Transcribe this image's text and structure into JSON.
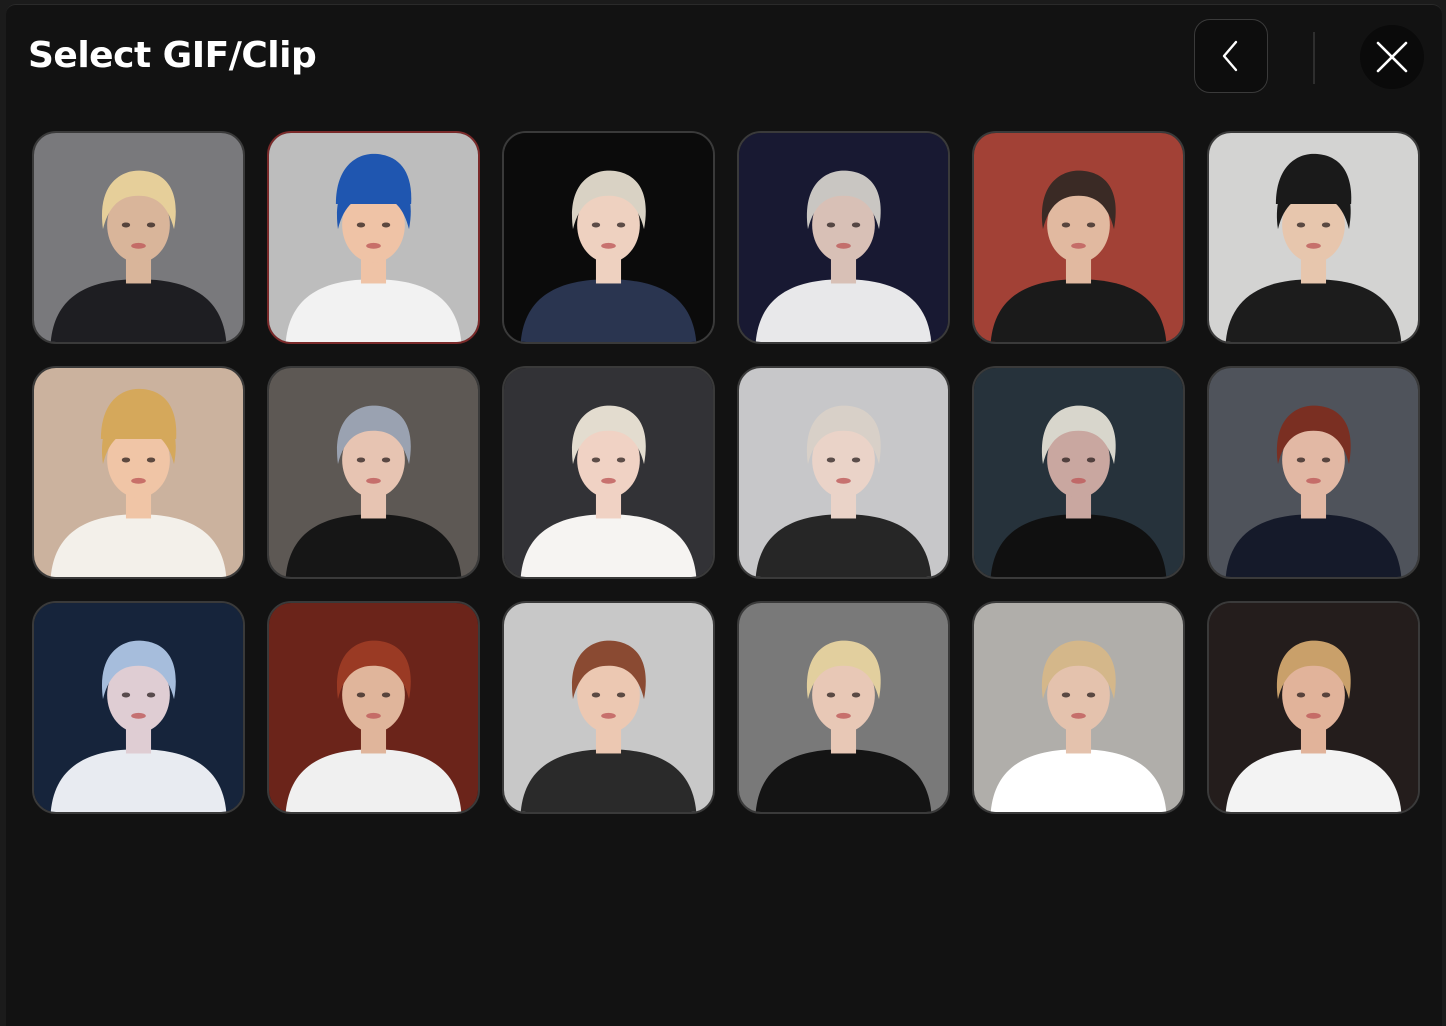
{
  "header": {
    "title": "Select GIF/Clip",
    "back_icon": "chevron-left-icon",
    "close_icon": "close-icon"
  },
  "selected_index": 1,
  "clips": [
    {
      "bg": "#8a8a8e",
      "hair": "#e6cf9a",
      "skin": "#d9b59a",
      "shirt": "#1e1e22"
    },
    {
      "bg": "#d8d8d8",
      "hair": "#1f56b0",
      "skin": "#efc3a6",
      "shirt": "#f2f2f2",
      "hat": true
    },
    {
      "bg": "#0d0d0d",
      "hair": "#d9d2c4",
      "skin": "#eed1c0",
      "shirt": "#2a3550"
    },
    {
      "bg": "#1c1d3a",
      "hair": "#c9c6c2",
      "skin": "#d8c0b6",
      "shirt": "#e8e8ea"
    },
    {
      "bg": "#b94a3e",
      "hair": "#3a2a25",
      "skin": "#e1b9a0",
      "shirt": "#1a1a1a"
    },
    {
      "bg": "#f1f1ef",
      "hair": "#1a1a1a",
      "skin": "#e7c6ad",
      "shirt": "#1c1c1c",
      "hat": true
    },
    {
      "bg": "#e8cbb4",
      "hair": "#d5a85b",
      "skin": "#f0c5a6",
      "shirt": "#f3f0ea",
      "hat": true
    },
    {
      "bg": "#6a6560",
      "hair": "#9aa2b1",
      "skin": "#e7c4b2",
      "shirt": "#161616"
    },
    {
      "bg": "#3a3a3e",
      "hair": "#e3dccf",
      "skin": "#f0d2c4",
      "shirt": "#f6f4f2"
    },
    {
      "bg": "#e3e3e5",
      "hair": "#d8d0c8",
      "skin": "#ead3c8",
      "shirt": "#262626"
    },
    {
      "bg": "#2c3a44",
      "hair": "#d8d6cc",
      "skin": "#c9a7a0",
      "shirt": "#101010"
    },
    {
      "bg": "#5a5f68",
      "hair": "#7a2f22",
      "skin": "#e2b8a4",
      "shirt": "#151a2a"
    },
    {
      "bg": "#1a2a44",
      "hair": "#a6bddc",
      "skin": "#dfcdd3",
      "shirt": "#e8ebf1"
    },
    {
      "bg": "#7a2a1e",
      "hair": "#9a3a24",
      "skin": "#e0b59b",
      "shirt": "#f0f0f0"
    },
    {
      "bg": "#e4e4e4",
      "hair": "#8a4a32",
      "skin": "#ecc8b2",
      "shirt": "#2a2a2a"
    },
    {
      "bg": "#8a8a8a",
      "hair": "#e2cf9e",
      "skin": "#e8c8b6",
      "shirt": "#141414"
    },
    {
      "bg": "#c9c6c2",
      "hair": "#d4b78a",
      "skin": "#e4c2ad",
      "shirt": "#ffffff"
    },
    {
      "bg": "#2a2220",
      "hair": "#c9a06a",
      "skin": "#e1b39a",
      "shirt": "#f3f3f3"
    }
  ]
}
